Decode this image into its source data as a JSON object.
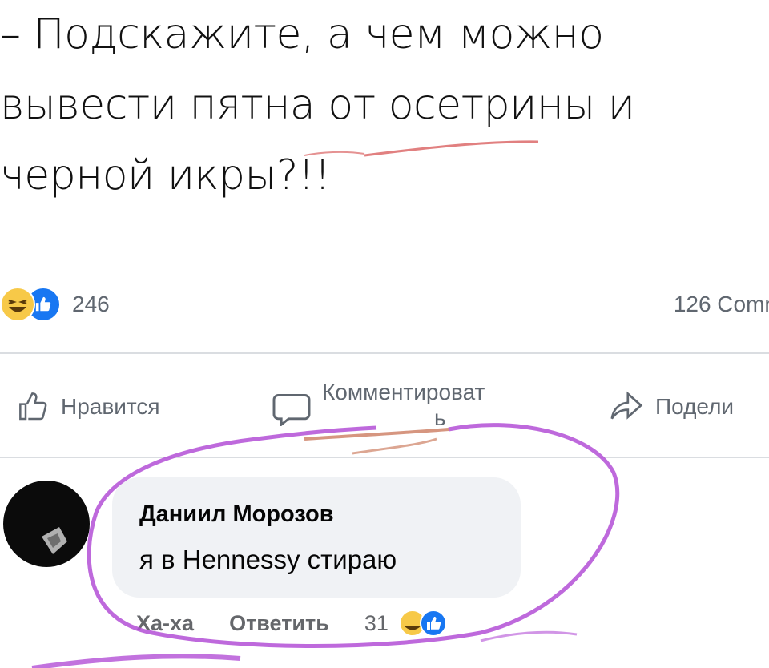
{
  "post": {
    "lines": [
      "– Подскажите, а чем можно",
      "вывести пятна от осетрины и",
      "черной икры?!!"
    ]
  },
  "stats": {
    "reaction_count": "246",
    "comments_label": "126 Comn"
  },
  "actions": {
    "like_label": "Нравится",
    "comment_label_line1": "Комментироват",
    "comment_label_line2": "ь",
    "share_label": "Подели"
  },
  "comment": {
    "author": "Даниил Морозов",
    "text": "я в Hennessy стираю",
    "haha_label": "Ха-ха",
    "reply_label": "Ответить",
    "reaction_count": "31"
  },
  "colors": {
    "facebook_blue": "#1877f2",
    "emoji_yellow": "#f7c948",
    "marker_purple": "#b34fd6",
    "underline_red": "#d44a4a"
  },
  "icons": [
    "laughing-emoji-icon",
    "like-badge-icon",
    "thumbs-up-icon",
    "comment-icon",
    "share-icon"
  ]
}
